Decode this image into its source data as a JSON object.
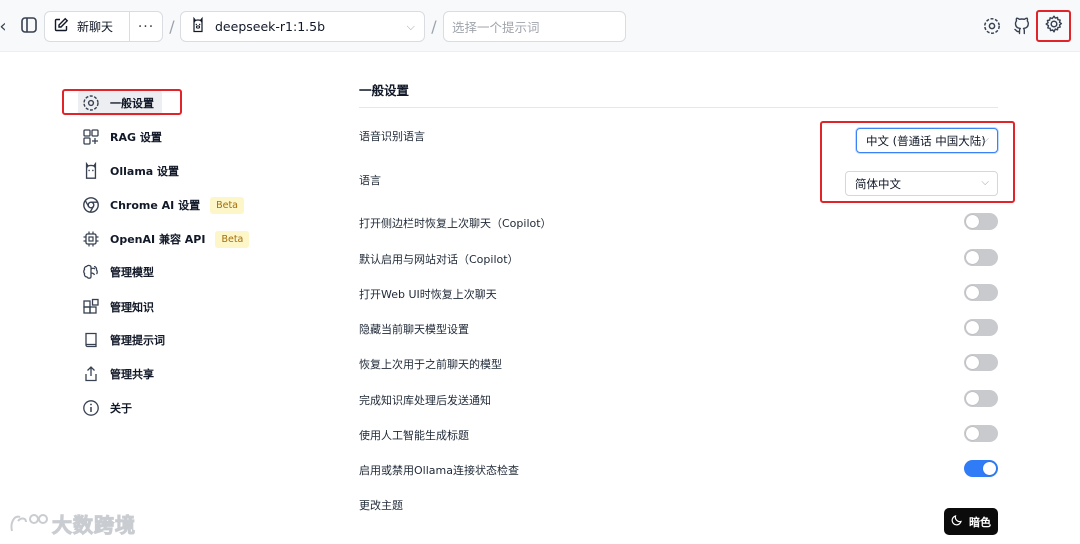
{
  "header": {
    "new_chat_label": "新聊天",
    "more_label": "···",
    "model_select": "deepseek-r1:1.5b",
    "prompt_placeholder": "选择一个提示词",
    "separator": "/"
  },
  "sidebar": {
    "items": [
      {
        "label": "一般设置",
        "icon": "gear-icon"
      },
      {
        "label": "RAG 设置",
        "icon": "rag-icon"
      },
      {
        "label": "Ollama 设置",
        "icon": "ollama-icon"
      },
      {
        "label": "Chrome AI 设置",
        "icon": "chrome-icon",
        "badge": "Beta"
      },
      {
        "label": "OpenAI 兼容 API",
        "icon": "cpu-icon",
        "badge": "Beta"
      },
      {
        "label": "管理模型",
        "icon": "brain-icon"
      },
      {
        "label": "管理知识",
        "icon": "blocks-icon"
      },
      {
        "label": "管理提示词",
        "icon": "book-icon"
      },
      {
        "label": "管理共享",
        "icon": "share-icon"
      },
      {
        "label": "关于",
        "icon": "info-icon"
      }
    ]
  },
  "main": {
    "section_title": "一般设置",
    "speech_language_label": "语音识别语言",
    "speech_language_value": "中文 (普通话 中国大陆)",
    "language_label": "语言",
    "language_value": "简体中文",
    "toggles": [
      {
        "label": "打开侧边栏时恢复上次聊天（Copilot）",
        "on": false
      },
      {
        "label": "默认启用与网站对话（Copilot）",
        "on": false
      },
      {
        "label": "打开Web UI时恢复上次聊天",
        "on": false
      },
      {
        "label": "隐藏当前聊天模型设置",
        "on": false
      },
      {
        "label": "恢复上次用于之前聊天的模型",
        "on": false
      },
      {
        "label": "完成知识库处理后发送通知",
        "on": false
      },
      {
        "label": "使用人工智能生成标题",
        "on": false
      },
      {
        "label": "启用或禁用Ollama连接状态检查",
        "on": true
      }
    ],
    "theme_label": "更改主题",
    "theme_button": "暗色"
  },
  "watermark": "大数跨境",
  "colors": {
    "accent": "#2f7cf6",
    "highlight_box": "#e0242a",
    "beta_bg": "#fcf6c9",
    "beta_text": "#a36d0a"
  }
}
